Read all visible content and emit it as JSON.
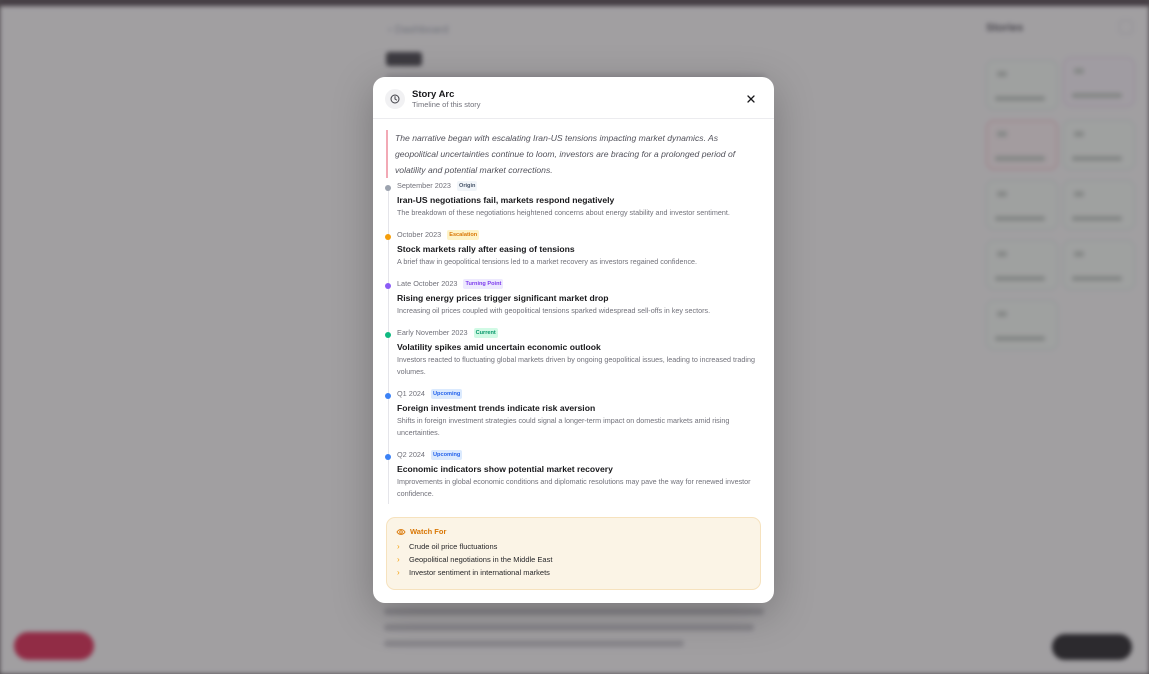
{
  "background": {
    "back_label": "‹ Dashboard",
    "side_title": "Stories"
  },
  "modal": {
    "title": "Story Arc",
    "subtitle": "Timeline of this story",
    "close_label": "×",
    "icon": "clock-icon",
    "narrative": "The narrative began with escalating Iran-US tensions impacting market dynamics. As geopolitical uncertainties continue to loom, investors are bracing for a prolonged period of volatility and potential market corrections.",
    "events": [
      {
        "date": "September 2023",
        "badge": "Origin",
        "badge_color": "#475569",
        "badge_bg": "#f1f5f9",
        "dot_color": "#9ca3af",
        "title": "Iran-US negotiations fail, markets respond negatively",
        "description": "The breakdown of these negotiations heightened concerns about energy stability and investor sentiment."
      },
      {
        "date": "October 2023",
        "badge": "Escalation",
        "badge_color": "#d97706",
        "badge_bg": "#fef3c7",
        "dot_color": "#f59e0b",
        "title": "Stock markets rally after easing of tensions",
        "description": "A brief thaw in geopolitical tensions led to a market recovery as investors regained confidence."
      },
      {
        "date": "Late October 2023",
        "badge": "Turning Point",
        "badge_color": "#7c3aed",
        "badge_bg": "#ede9fe",
        "dot_color": "#8b5cf6",
        "title": "Rising energy prices trigger significant market drop",
        "description": "Increasing oil prices coupled with geopolitical tensions sparked widespread sell-offs in key sectors."
      },
      {
        "date": "Early November 2023",
        "badge": "Current",
        "badge_color": "#059669",
        "badge_bg": "#d1fae5",
        "dot_color": "#10b981",
        "title": "Volatility spikes amid uncertain economic outlook",
        "description": "Investors reacted to fluctuating global markets driven by ongoing geopolitical issues, leading to increased trading volumes."
      },
      {
        "date": "Q1 2024",
        "badge": "Upcoming",
        "badge_color": "#2563eb",
        "badge_bg": "#dbeafe",
        "dot_color": "#3b82f6",
        "title": "Foreign investment trends indicate risk aversion",
        "description": "Shifts in foreign investment strategies could signal a longer-term impact on domestic markets amid rising uncertainties."
      },
      {
        "date": "Q2 2024",
        "badge": "Upcoming",
        "badge_color": "#2563eb",
        "badge_bg": "#dbeafe",
        "dot_color": "#3b82f6",
        "title": "Economic indicators show potential market recovery",
        "description": "Improvements in global economic conditions and diplomatic resolutions may pave the way for renewed investor confidence."
      }
    ],
    "watch": {
      "title": "Watch For",
      "icon": "eye-icon",
      "items": [
        "Crude oil price fluctuations",
        "Geopolitical negotiations in the Middle East",
        "Investor sentiment in international markets"
      ]
    }
  }
}
